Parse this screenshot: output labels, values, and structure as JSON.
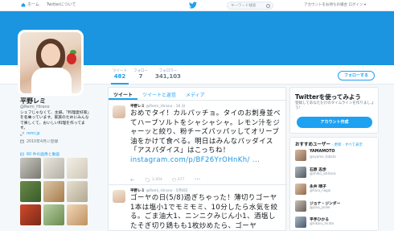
{
  "topbar": {
    "home_label": "ホーム",
    "about_label": "Twitterについて",
    "search_placeholder": "キーワード検索",
    "account_prompt": "アカウントをお持ちの場合 ログイン ▾"
  },
  "stats": [
    {
      "label": "ツイート",
      "value": "482"
    },
    {
      "label": "フォロー",
      "value": "7"
    },
    {
      "label": "フォロワー",
      "value": "341,103"
    }
  ],
  "follow_button": "フォローする",
  "profile": {
    "name": "平野レミ",
    "handle": "@Remi_Hirano",
    "bio": "シェフじゃなくて、主婦。「料理愛好家」を名乗っています。家族のためにみんなで楽しくて、おいしい料理を作ってます。",
    "link": "remi.jp",
    "joined": "2010年4月に登録",
    "photos_label": "60 件の画像と動画"
  },
  "tabs": [
    "ツイート",
    "ツイートと返信",
    "メディア"
  ],
  "tweets": [
    {
      "author": "平野レミ",
      "handle": "@Remi_Hirano",
      "time": "16 分",
      "text": "おめでタイ！カルパッチョ。タイのお刺身並べてハーブソルトをシャシャシャ。レモン汁をジャーッと絞り、粉チーズパッパッしてオリーブ油をかけて食べる。明日はみんなパッダイス「アスパダイス」はこっちね！",
      "link": "instagram.com/p/BF26YrOHnKh/",
      "link_suffix": " ...",
      "actions": {
        "retweets": "1,404",
        "likes": "677"
      }
    },
    {
      "author": "平野レミ",
      "handle": "@Remi_Hirano",
      "time": "5月8日",
      "text": "ゴーヤの日(5/8)過ぎちゃった！薄切りゴーヤ1本は塩小1でモミモミ、10分したら水気を絞る。ごま油大1、ニンニクみじん小1、酒塩したそぎ切り鶏もも1枚炒めたら、ゴーヤ"
    }
  ],
  "signup": {
    "title": "Twitterを使ってみよう",
    "subtitle": "登録してあなただけのタイムラインを作りましょう！",
    "button": "アカウント作成"
  },
  "suggestions": {
    "title": "おすすめユーザー",
    "refresh": "· 更新 · すべて表示",
    "users": [
      {
        "name": "YAMAMOTO",
        "handle": "@ayame_tabata"
      },
      {
        "name": "石原 志歩",
        "handle": "@shiho_ishihara"
      },
      {
        "name": "永井 晴子",
        "handle": "@haru_nagai"
      },
      {
        "name": "ジョナ・ジンダー",
        "handle": "@jona_jinder"
      },
      {
        "name": "平手ひかる",
        "handle": "@hikaru_hirate"
      }
    ]
  },
  "colors": {
    "accent": "#1da1f2",
    "banner": "#1b95e0"
  }
}
